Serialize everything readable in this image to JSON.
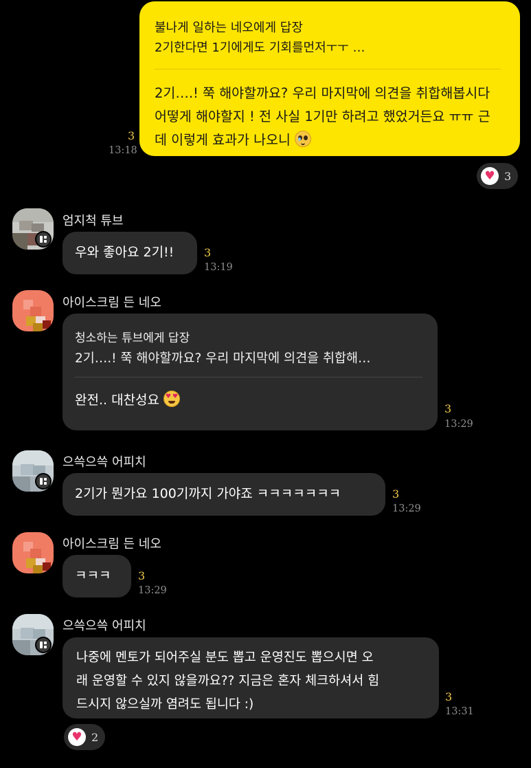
{
  "colors": {
    "my_bubble": "#FEE500",
    "other_bubble": "#2b2b2b",
    "unread": "#F2C94C",
    "background": "#000000",
    "heart": "#e8336a"
  },
  "messages": {
    "m1": {
      "reply_to": "불나게 일하는 네오에게 답장",
      "quoted": "2기한다면 1기에게도 기회를먼저ㅜㅜ …",
      "text": "2기….! 쭉 해야할까요? 우리 마지막에 의견을 취합해봅시다 어떻게 해야할지 ! 전 사실 1기만 하려고 했었거든요 ㅠㅠ 근데 이렇게 효과가 나오니",
      "emoji": "pleading-face-emoji",
      "unread": "3",
      "time": "13:18",
      "reaction_count": "3"
    },
    "m2": {
      "sender": "엄지척 튜브",
      "text": "우와 좋아요 2기!!",
      "unread": "3",
      "time": "13:19"
    },
    "m3": {
      "sender": "아이스크림 든 네오",
      "reply_to": "청소하는 튜브에게 답장",
      "quoted": "2기….! 쭉 해야할까요? 우리 마지막에 의견을 취합해…",
      "text": "완전.. 대찬성요",
      "emoji": "heart-eyes-emoji",
      "unread": "3",
      "time": "13:29"
    },
    "m4": {
      "sender": "으쓱으쓱 어피치",
      "text": "2기가 뭔가요 100기까지 가야죠 ㅋㅋㅋㅋㅋㅋㅋ",
      "unread": "3",
      "time": "13:29"
    },
    "m5": {
      "sender": "아이스크림 든 네오",
      "text": "ㅋㅋㅋ",
      "unread": "3",
      "time": "13:29"
    },
    "m6": {
      "sender": "으쓱으쓱 어피치",
      "line1": "나중에 멘토가 되어주실 분도 뽑고 운영진도 뽑으시면 오",
      "line2": "래 운영할 수 있지 않을까요?? 지금은 혼자 체크하셔서 힘",
      "line3": "드시지 않으실까 염려도 됩니다 :)",
      "unread": "3",
      "time": "13:31",
      "reaction_count": "2"
    }
  },
  "icons": {
    "reaction": "heart-icon",
    "avatar_badge": "multi-profile-icon"
  }
}
